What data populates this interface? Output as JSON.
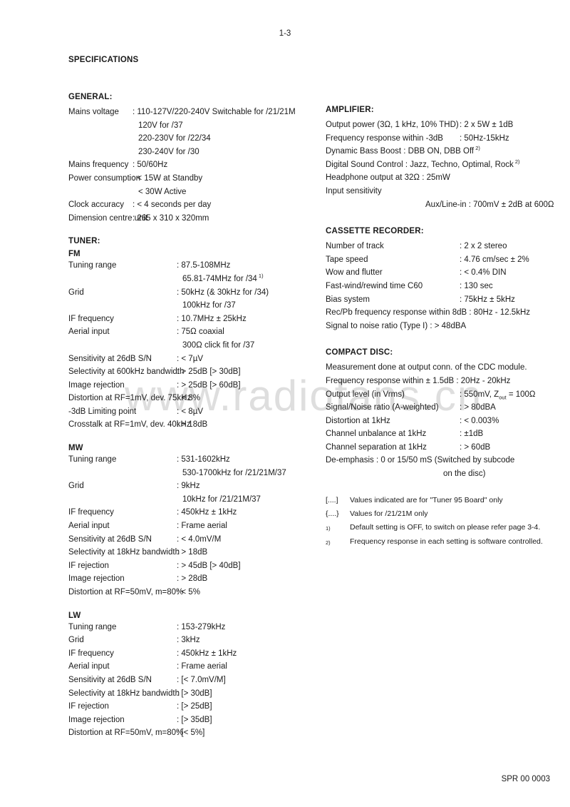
{
  "page": {
    "number": "1-3",
    "doc_code": "SPR 00 0003",
    "title": "SPECIFICATIONS",
    "watermark": "www.radiofans.cn"
  },
  "general": {
    "heading": "GENERAL:",
    "rows": [
      {
        "label": "Mains voltage",
        "value": ": 110-127V/220-240V Switchable for /21/21M"
      },
      {
        "label": "",
        "value": "120V for /37"
      },
      {
        "label": "",
        "value": "220-230V for /22/34"
      },
      {
        "label": "",
        "value": "230-240V for /30"
      },
      {
        "label": "Mains frequency",
        "value": ": 50/60Hz"
      },
      {
        "label": "Power consumption",
        "value": ": < 15W at Standby"
      },
      {
        "label": "",
        "value": "< 30W Active"
      },
      {
        "label": "Clock accuracy",
        "value": ": < 4 seconds per day"
      },
      {
        "label": "Dimension centre unit",
        "value": ": 265 x 310 x 320mm"
      }
    ]
  },
  "tuner": {
    "heading": "TUNER:",
    "fm": {
      "sub_heading": "FM",
      "rows": [
        {
          "label": "Tuning range",
          "value": ": 87.5-108MHz"
        },
        {
          "label": "",
          "value": "65.81-74MHz for /34",
          "sup": "1)"
        },
        {
          "label": "Grid",
          "value": ": 50kHz (& 30kHz for /34)"
        },
        {
          "label": "",
          "value": "100kHz for /37"
        },
        {
          "label": "IF frequency",
          "value": ": 10.7MHz ± 25kHz"
        },
        {
          "label": "Aerial input",
          "value": ": 75Ω coaxial"
        },
        {
          "label": "",
          "value": "300Ω click fit for /37"
        },
        {
          "label": "Sensitivity at 26dB S/N",
          "value": ": < 7µV"
        },
        {
          "label": "Selectivity at 600kHz bandwidth",
          "value": ": > 25dB [> 30dB]"
        },
        {
          "label": "Image rejection",
          "value": ": > 25dB [> 60dB]"
        },
        {
          "label": "Distortion at RF=1mV, dev. 75kHz",
          "value": ": < 3%"
        },
        {
          "label": "-3dB Limiting point",
          "value": ": < 8µV"
        },
        {
          "label": "Crosstalk at RF=1mV, dev. 40kHz",
          "value": ": > 18dB"
        }
      ]
    },
    "mw": {
      "sub_heading": "MW",
      "rows": [
        {
          "label": "Tuning range",
          "value": ": 531-1602kHz"
        },
        {
          "label": "",
          "value": "530-1700kHz for /21/21M/37"
        },
        {
          "label": "Grid",
          "value": ": 9kHz"
        },
        {
          "label": "",
          "value": "10kHz for /21/21M/37"
        },
        {
          "label": "IF frequency",
          "value": ": 450kHz ± 1kHz"
        },
        {
          "label": "Aerial input",
          "value": ": Frame aerial"
        },
        {
          "label": "Sensitivity at 26dB S/N",
          "value": ": < 4.0mV/M"
        },
        {
          "label": "Selectivity at 18kHz bandwidth",
          "value": ": > 18dB"
        },
        {
          "label": "IF rejection",
          "value": ": > 45dB [> 40dB]"
        },
        {
          "label": "Image rejection",
          "value": ": > 28dB"
        },
        {
          "label": "Distortion at RF=50mV, m=80%",
          "value": ": < 5%"
        }
      ]
    },
    "lw": {
      "sub_heading": "LW",
      "rows": [
        {
          "label": "Tuning range",
          "value": ": 153-279kHz"
        },
        {
          "label": "Grid",
          "value": ": 3kHz"
        },
        {
          "label": "IF frequency",
          "value": ": 450kHz ± 1kHz"
        },
        {
          "label": "Aerial input",
          "value": ": Frame aerial"
        },
        {
          "label": "Sensitivity at 26dB S/N",
          "value": ": [< 7.0mV/M]"
        },
        {
          "label": "Selectivity at 18kHz bandwidth",
          "value": ": [> 30dB]"
        },
        {
          "label": "IF rejection",
          "value": ": [> 25dB]"
        },
        {
          "label": "Image rejection",
          "value": ": [> 35dB]"
        },
        {
          "label": "Distortion at RF=50mV, m=80%",
          "value": ": [< 5%]"
        }
      ]
    }
  },
  "amplifier": {
    "heading": "AMPLIFIER:",
    "rows": [
      {
        "label": "Output power (3Ω, 1 kHz, 10% THD)",
        "value": ": 2 x 5W ± 1dB"
      },
      {
        "label": "Frequency response within -3dB",
        "value": ": 50Hz-15kHz"
      }
    ],
    "free_rows": [
      {
        "text": "Dynamic Bass Boost     : DBB ON, DBB Off",
        "sup": "2)"
      },
      {
        "text": "Digital Sound Control   : Jazz, Techno, Optimal, Rock",
        "sup": "2)"
      },
      {
        "text": "Headphone output at 32Ω         : 25mW",
        "sup": ""
      },
      {
        "text": "Input sensitivity",
        "sup": ""
      },
      {
        "text": "Aux/Line-in  : 700mV ± 2dB at 600Ω",
        "sup": "",
        "indent": 140
      }
    ]
  },
  "cassette": {
    "heading": "CASSETTE RECORDER:",
    "rows": [
      {
        "label": "Number of track",
        "value": ": 2 x 2 stereo"
      },
      {
        "label": "Tape speed",
        "value": ": 4.76 cm/sec ± 2%"
      },
      {
        "label": "Wow and flutter",
        "value": ": < 0.4% DIN"
      },
      {
        "label": "Fast-wind/rewind time C60",
        "value": ": 130 sec"
      },
      {
        "label": "Bias system",
        "value": ": 75kHz ± 5kHz"
      }
    ],
    "free_rows": [
      {
        "text": "Rec/Pb frequency response within 8dB    : 80Hz - 12.5kHz"
      },
      {
        "text": "Signal to noise ratio (Type I)              : > 48dBA"
      }
    ]
  },
  "compact_disc": {
    "heading": "COMPACT DISC:",
    "intro": "Measurement done at output conn. of the CDC module.",
    "free_rows": [
      {
        "text": "Frequency response within ± 1.5dB : 20Hz - 20kHz"
      }
    ],
    "output_level": {
      "label": "Output level (in Vrms)",
      "value_pre": ": 550mV, Z",
      "value_sub": "out",
      "value_post": " = 100Ω"
    },
    "rows": [
      {
        "label": "Signal/Noise ratio (A-weighted)",
        "value": ": > 80dBA"
      },
      {
        "label": "Distortion at 1kHz",
        "value": ": < 0.003%"
      },
      {
        "label": "Channel unbalance at 1kHz",
        "value": ": ±1dB"
      },
      {
        "label": "Channel separation at 1kHz",
        "value": ": > 60dB"
      }
    ],
    "de_emphasis": {
      "line1": "De-emphasis       : 0 or 15/50 mS (Switched by subcode",
      "line2": "on the disc)"
    }
  },
  "footnotes": [
    {
      "mark": "[....]",
      "superscript": false,
      "text": "Values indicated are for \"Tuner 95 Board\" only"
    },
    {
      "mark": "{....}",
      "superscript": false,
      "text": "Values for /21/21M only"
    },
    {
      "mark": "1)",
      "superscript": true,
      "text": "Default setting is OFF, to switch on please refer page 3-4."
    },
    {
      "mark": "2)",
      "superscript": true,
      "text": "Frequency response in each setting is software controlled."
    }
  ]
}
